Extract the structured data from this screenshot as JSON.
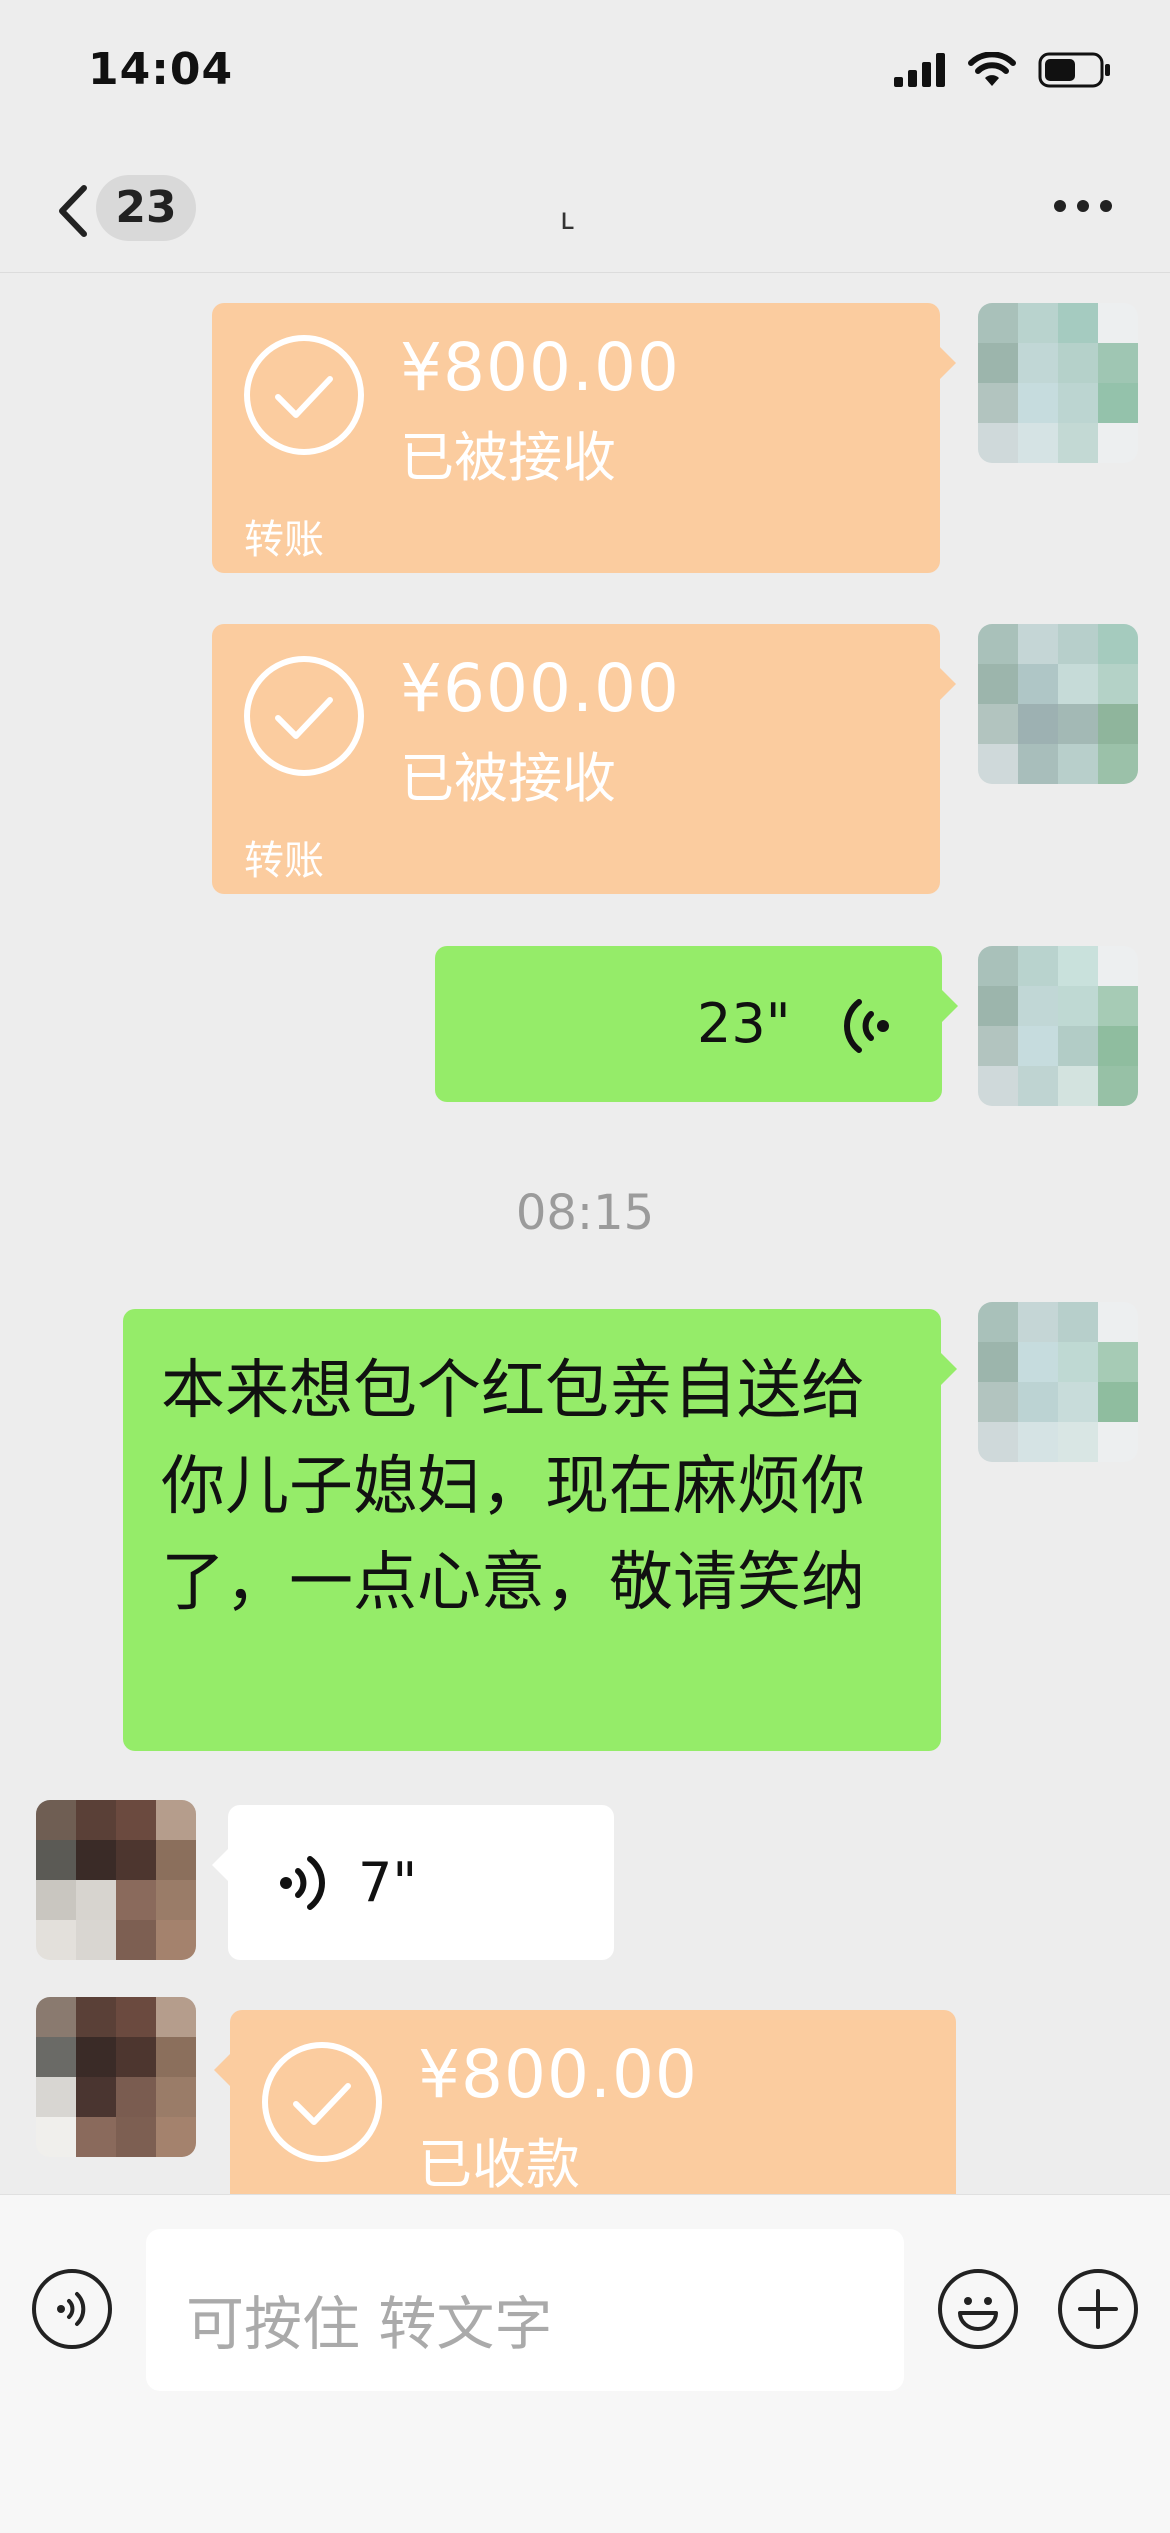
{
  "status_bar": {
    "time": "14:04"
  },
  "nav": {
    "unread_count": "23",
    "title": "ւ"
  },
  "messages": [
    {
      "type": "transfer",
      "amount": "¥800.00",
      "status": "已被接收",
      "label": "转账"
    },
    {
      "type": "transfer",
      "amount": "¥600.00",
      "status": "已被接收",
      "label": "转账"
    },
    {
      "type": "voice",
      "duration": "23\""
    },
    {
      "type": "timestamp",
      "text": "08:15"
    },
    {
      "type": "text",
      "text": "本来想包个红包亲自送给你儿子媳妇，现在麻烦你了，一点心意，敬请笑纳"
    },
    {
      "type": "voice",
      "duration": "7\""
    },
    {
      "type": "transfer",
      "amount": "¥800.00",
      "status": "已收款"
    }
  ],
  "input": {
    "placeholder": "可按住 转文字"
  },
  "icons": [
    "back-chevron-icon",
    "more-icon",
    "signal-icon",
    "wifi-icon",
    "battery-icon",
    "check-icon",
    "voice-wave-icon",
    "voice-toggle-icon",
    "emoji-icon",
    "plus-icon"
  ],
  "colors": {
    "transfer": "#fbcc9f",
    "my_bubble": "#95ec69",
    "their_bubble": "#ffffff",
    "background": "#ededed"
  }
}
